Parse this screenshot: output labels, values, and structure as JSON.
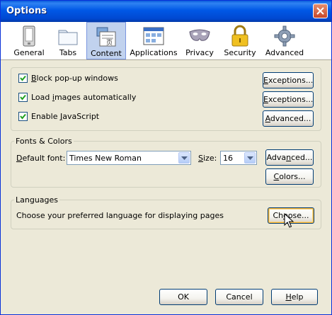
{
  "window": {
    "title": "Options"
  },
  "toolbar": {
    "items": [
      {
        "label": "General",
        "icon": "general-icon"
      },
      {
        "label": "Tabs",
        "icon": "tabs-icon"
      },
      {
        "label": "Content",
        "icon": "content-icon"
      },
      {
        "label": "Applications",
        "icon": "applications-icon"
      },
      {
        "label": "Privacy",
        "icon": "privacy-icon"
      },
      {
        "label": "Security",
        "icon": "security-icon"
      },
      {
        "label": "Advanced",
        "icon": "advanced-icon"
      }
    ],
    "selected": "Content"
  },
  "content": {
    "block_popups": {
      "pre": "",
      "key": "B",
      "post": "lock pop-up windows",
      "checked": true
    },
    "load_images": {
      "pre": "Load ",
      "key": "i",
      "post": "mages automatically",
      "checked": true
    },
    "enable_js": {
      "pre": "Enable ",
      "key": "J",
      "post": "avaScript",
      "checked": true
    },
    "exceptions1": {
      "pre": "",
      "key": "E",
      "post": "xceptions..."
    },
    "exceptions2": {
      "pre": "",
      "key": "E",
      "post": "xceptions..."
    },
    "advanced": {
      "pre": "",
      "key": "A",
      "post": "dvanced..."
    }
  },
  "fonts": {
    "group_label": "Fonts & Colors",
    "default_font_label": {
      "pre": "",
      "key": "D",
      "post": "efault font:"
    },
    "default_font_value": "Times New Roman",
    "size_label": {
      "pre": "",
      "key": "S",
      "post": "ize:"
    },
    "size_value": "16",
    "advanced": {
      "pre": "Adva",
      "key": "n",
      "post": "ced..."
    },
    "colors": {
      "pre": "",
      "key": "C",
      "post": "olors..."
    }
  },
  "languages": {
    "group_label": "Languages",
    "description": "Choose your preferred language for displaying pages",
    "choose": {
      "pre": "Ch",
      "key": "o",
      "post": "ose..."
    }
  },
  "footer": {
    "ok": "OK",
    "cancel": "Cancel",
    "help": {
      "pre": "",
      "key": "H",
      "post": "elp"
    }
  },
  "colors": {
    "titlebar": "#0058e6",
    "selected_tab": "#c1d2ee",
    "dialog_bg": "#ece9d8"
  }
}
